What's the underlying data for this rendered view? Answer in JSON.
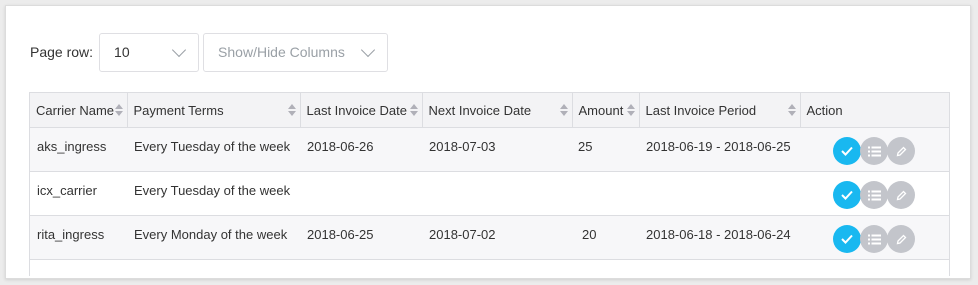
{
  "controls": {
    "page_row_label": "Page row:",
    "page_row_value": "10",
    "columns_label": "Show/Hide Columns"
  },
  "table": {
    "headers": [
      "Carrier Name",
      "Payment Terms",
      "Last Invoice Date",
      "Next Invoice Date",
      "Amount",
      "Last Invoice Period",
      "Action"
    ],
    "rows": [
      {
        "carrier": "aks_ingress",
        "terms": "Every Tuesday of the week",
        "last_date": "2018-06-26",
        "next_date": "2018-07-03",
        "amount": "25",
        "period": "2018-06-19 - 2018-06-25"
      },
      {
        "carrier": "icx_carrier",
        "terms": "Every Tuesday of the week",
        "last_date": "",
        "next_date": "",
        "amount": "",
        "period": ""
      },
      {
        "carrier": "rita_ingress",
        "terms": "Every Monday of the week",
        "last_date": "2018-06-25",
        "next_date": "2018-07-02",
        "amount": "20",
        "period": "2018-06-18 - 2018-06-24"
      }
    ]
  },
  "colors": {
    "accent": "#19b8f0",
    "muted_action": "#c3c5cb",
    "header_bg": "#f3f3f5"
  },
  "icons": {
    "confirm": "check-icon",
    "list": "list-icon",
    "edit": "pencil-icon"
  }
}
